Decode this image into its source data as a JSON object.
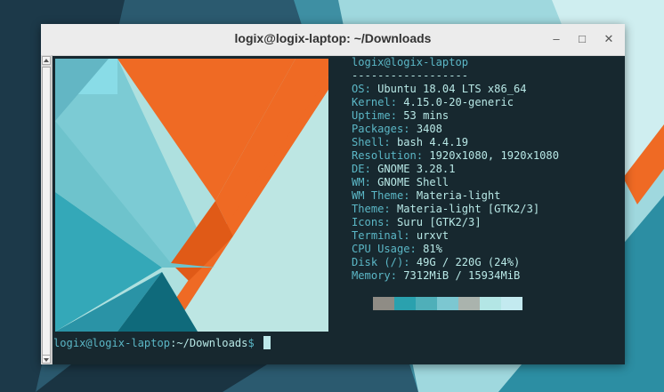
{
  "window": {
    "title": "logix@logix-laptop: ~/Downloads",
    "minimize_icon": "minimize-icon",
    "maximize_icon": "maximize-icon",
    "close_icon": "close-icon"
  },
  "neofetch": {
    "header": "logix@logix-laptop",
    "separator": "------------------",
    "rows": [
      {
        "key": "OS",
        "value": "Ubuntu 18.04 LTS x86_64"
      },
      {
        "key": "Kernel",
        "value": "4.15.0-20-generic"
      },
      {
        "key": "Uptime",
        "value": "53 mins"
      },
      {
        "key": "Packages",
        "value": "3408"
      },
      {
        "key": "Shell",
        "value": "bash 4.4.19"
      },
      {
        "key": "Resolution",
        "value": "1920x1080, 1920x1080"
      },
      {
        "key": "DE",
        "value": "GNOME 3.28.1"
      },
      {
        "key": "WM",
        "value": "GNOME Shell"
      },
      {
        "key": "WM Theme",
        "value": "Materia-light"
      },
      {
        "key": "Theme",
        "value": "Materia-light [GTK2/3]"
      },
      {
        "key": "Icons",
        "value": "Suru [GTK2/3]"
      },
      {
        "key": "Terminal",
        "value": "urxvt"
      },
      {
        "key": "CPU Usage",
        "value": "81%"
      },
      {
        "key": "Disk (/)",
        "value": "49G / 220G (24%)"
      },
      {
        "key": "Memory",
        "value": "7312MiB / 15934MiB"
      }
    ],
    "palette": [
      "#8f8c85",
      "#2aa1ae",
      "#4fafb9",
      "#7cc7d1",
      "#aab3ad",
      "#b3e6e5",
      "#c3eaf0"
    ]
  },
  "prompt": {
    "user_host": "logix@logix-laptop",
    "cwd": "~/Downloads",
    "symbol": "$"
  },
  "colors": {
    "terminal_bg": "#17282f",
    "key_color": "#5bb7c6",
    "value_color": "#b8e8e6",
    "accent_orange": "#ef6a24"
  }
}
